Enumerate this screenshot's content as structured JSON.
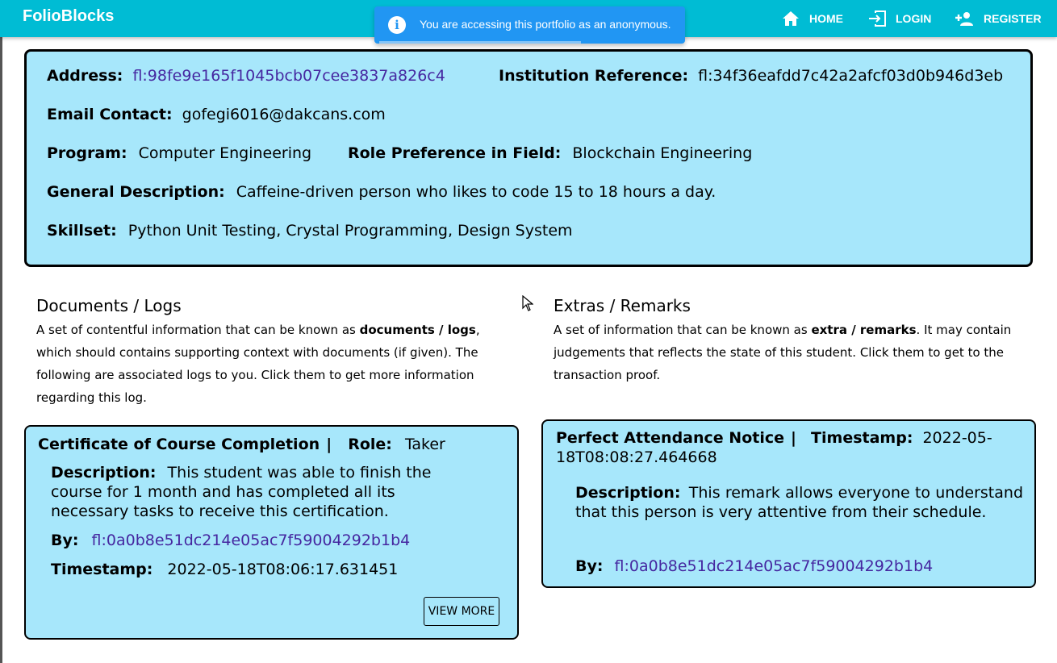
{
  "app": {
    "brand": "FolioBlocks"
  },
  "nav": {
    "home": "HOME",
    "login": "LOGIN",
    "register": "REGISTER"
  },
  "toast": {
    "message": "You are accessing this portfolio as an anonymous.",
    "icon": "info-icon"
  },
  "profile": {
    "address_label": "Address:",
    "address_value": "fl:98fe9e165f1045bcb07cee3837a826c4",
    "institution_label": "Institution Reference:",
    "institution_value": "fl:34f36eafdd7c42a2afcf03d0b946d3eb",
    "email_label": "Email Contact:",
    "email_value": "gofegi6016@dakcans.com",
    "program_label": "Program:",
    "program_value": "Computer Engineering",
    "role_label": "Role Preference in Field:",
    "role_value": "Blockchain Engineering",
    "description_label": "General Description:",
    "description_value": "Caffeine-driven person who likes to code 15 to 18 hours a day.",
    "skillset_label": "Skillset:",
    "skillset_value": "Python Unit Testing, Crystal Programming, Design System"
  },
  "documents": {
    "title": "Documents / Logs",
    "desc_part1": "A set of contentful information that can be known as ",
    "desc_bold": "documents / logs",
    "desc_part2": ", which should contains supporting context with documents (if given). The following are associated logs to you. Click them to get more information regarding this log.",
    "card": {
      "title": "Certificate of Course Completion",
      "separator": "|",
      "role_label": "Role:",
      "role_value": "Taker",
      "description_label": "Description:",
      "description_value": "This student was able to finish the course for 1 month and has completed all its necessary tasks to receive this certification.",
      "by_label": "By:",
      "by_value": "fl:0a0b8e51dc214e05ac7f59004292b1b4",
      "timestamp_label": "Timestamp:",
      "timestamp_value": "2022-05-18T08:06:17.631451",
      "view_more_label": "VIEW MORE"
    }
  },
  "extras": {
    "title": "Extras / Remarks",
    "desc_part1": "A set of information that can be known as ",
    "desc_bold": "extra / remarks",
    "desc_part2": ". It may contain judgements that reflects the state of this student. Click them to get to the transaction proof.",
    "card": {
      "title": "Perfect Attendance Notice",
      "separator": "|",
      "timestamp_label": "Timestamp:",
      "timestamp_value": "2022-05-18T08:08:27.464668",
      "description_label": "Description:",
      "description_value": "This remark allows everyone to understand that this person is very attentive from their schedule.",
      "by_label": "By:",
      "by_value": "fl:0a0b8e51dc214e05ac7f59004292b1b4"
    }
  }
}
